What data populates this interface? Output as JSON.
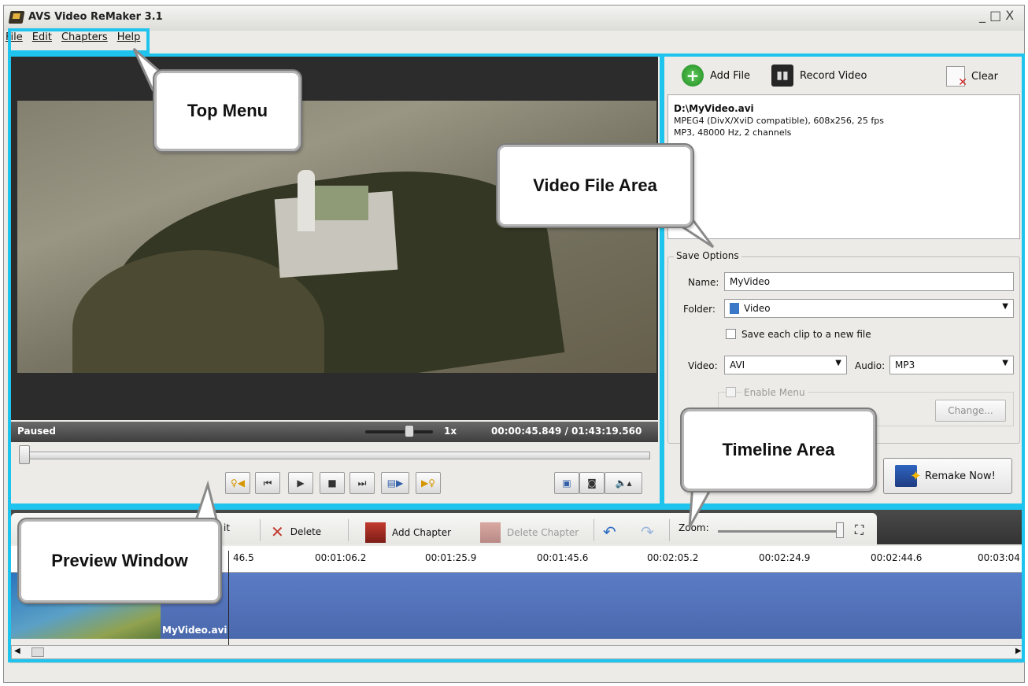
{
  "window": {
    "title": "AVS Video ReMaker 3.1",
    "controls": "_ □ X"
  },
  "menu": {
    "items": [
      "File",
      "Edit",
      "Chapters",
      "Help"
    ]
  },
  "preview": {
    "status": "Paused",
    "speed": "1x",
    "time": "00:00:45.849 / 01:43:19.560"
  },
  "playback_buttons": [
    "marker-left",
    "prev-frame",
    "play",
    "stop",
    "next-frame",
    "scene",
    "marker-right"
  ],
  "right_buttons": [
    "video-effect",
    "snapshot",
    "volume"
  ],
  "file_toolbar": {
    "add_file": "Add File",
    "record_video": "Record Video",
    "clear": "Clear"
  },
  "file": {
    "name": "D:\\MyVideo.avi",
    "line1": "MPEG4 (DivX/XviD compatible), 608x256, 25 fps",
    "line2": "MP3, 48000 Hz, 2 channels"
  },
  "save_options": {
    "title": "Save Options",
    "name_label": "Name:",
    "name_value": "MyVideo",
    "folder_label": "Folder:",
    "folder_value": "Video",
    "save_each_label": "Save each clip to a new file",
    "video_label": "Video:",
    "video_value": "AVI",
    "audio_label": "Audio:",
    "audio_value": "MP3",
    "enable_menu_label": "Enable Menu",
    "change_label": "Change...",
    "remake_label": "Remake Now!"
  },
  "timeline": {
    "edit_label": "it",
    "delete_label": "Delete",
    "add_chapter_label": "Add Chapter",
    "delete_chapter_label": "Delete Chapter",
    "zoom_label": "Zoom:",
    "ticks": [
      "46.5",
      "00:01:06.2",
      "00:01:25.9",
      "00:01:45.6",
      "00:02:05.2",
      "00:02:24.9",
      "00:02:44.6",
      "00:03:04"
    ],
    "clip_name": "MyVideo.avi"
  },
  "callouts": {
    "top_menu": "Top Menu",
    "video_file_area": "Video File Area",
    "timeline_area": "Timeline Area",
    "preview_window": "Preview Window"
  },
  "colors": {
    "highlight": "#1fc4ee",
    "track": "#5b7cc6"
  }
}
